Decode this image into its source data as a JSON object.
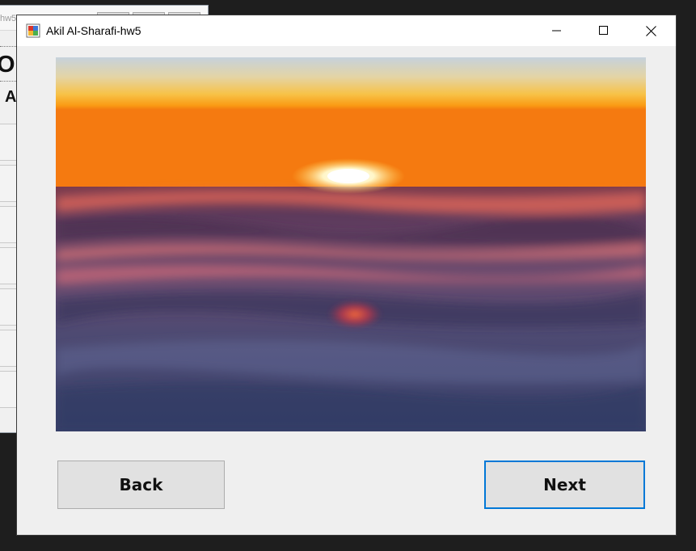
{
  "background_window": {
    "title_fragment": "hw5",
    "heading_fragment": "O",
    "subheading_fragment": "A"
  },
  "window": {
    "title": "Akil Al-Sharafi-hw5",
    "controls": {
      "minimize_icon": "minimize-icon",
      "maximize_icon": "maximize-icon",
      "close_icon": "close-icon"
    }
  },
  "image": {
    "description_icon": "sunset-above-clouds-photo"
  },
  "buttons": {
    "back_label": "Back",
    "next_label": "Next"
  },
  "colors": {
    "focus_border": "#0078d7",
    "button_face": "#e1e1e1",
    "window_bg": "#efefef"
  }
}
